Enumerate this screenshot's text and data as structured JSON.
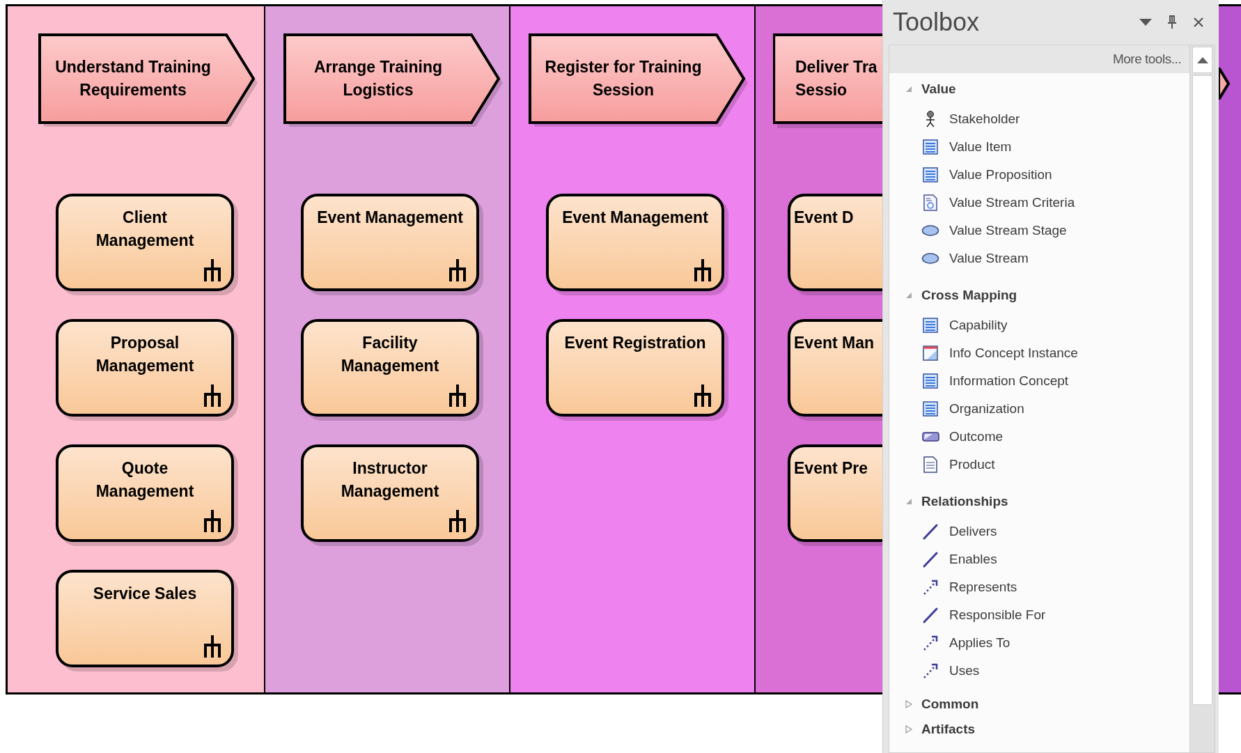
{
  "diagram": {
    "stages": [
      {
        "label": [
          "Understand Training",
          "Requirements"
        ],
        "color": "#fdbfcf",
        "capabilities": [
          {
            "label": [
              "Client",
              "Management"
            ]
          },
          {
            "label": [
              "Proposal",
              "Management"
            ]
          },
          {
            "label": [
              "Quote",
              "Management"
            ]
          },
          {
            "label": [
              "Service Sales"
            ]
          }
        ]
      },
      {
        "label": [
          "Arrange Training",
          "Logistics"
        ],
        "color": "#dda0dd",
        "capabilities": [
          {
            "label": [
              "Event Management"
            ]
          },
          {
            "label": [
              "Facility",
              "Management"
            ]
          },
          {
            "label": [
              "Instructor",
              "Management"
            ]
          }
        ]
      },
      {
        "label": [
          "Register for Training",
          "Session"
        ],
        "color": "#ee82ee",
        "capabilities": [
          {
            "label": [
              "Event Management"
            ]
          },
          {
            "label": [
              "Event Registration"
            ]
          }
        ]
      },
      {
        "label": [
          "Deliver Tra",
          "Sessio"
        ],
        "color": "#da70d6",
        "capabilities": [
          {
            "label": [
              "Event D"
            ]
          },
          {
            "label": [
              "Event Man"
            ]
          },
          {
            "label": [
              "Event Pre"
            ]
          }
        ]
      }
    ],
    "next_stage": {
      "color": "#b955d0"
    }
  },
  "toolbox": {
    "title": "Toolbox",
    "more_tools": "More tools...",
    "groups": [
      {
        "name": "Value",
        "expanded": true,
        "items": [
          {
            "label": "Stakeholder",
            "kind": "stakeholder"
          },
          {
            "label": "Value Item",
            "kind": "element"
          },
          {
            "label": "Value Proposition",
            "kind": "element"
          },
          {
            "label": "Value Stream Criteria",
            "kind": "criteria"
          },
          {
            "label": "Value Stream Stage",
            "kind": "stage"
          },
          {
            "label": "Value Stream",
            "kind": "stage"
          }
        ]
      },
      {
        "name": "Cross Mapping",
        "expanded": true,
        "items": [
          {
            "label": "Capability",
            "kind": "element"
          },
          {
            "label": "Info Concept Instance",
            "kind": "instance"
          },
          {
            "label": "Information Concept",
            "kind": "element"
          },
          {
            "label": "Organization",
            "kind": "element"
          },
          {
            "label": "Outcome",
            "kind": "outcome"
          },
          {
            "label": "Product",
            "kind": "product"
          }
        ]
      },
      {
        "name": "Relationships",
        "expanded": true,
        "items": [
          {
            "label": "Delivers",
            "kind": "association"
          },
          {
            "label": "Enables",
            "kind": "association"
          },
          {
            "label": "Represents",
            "kind": "dependency"
          },
          {
            "label": "Responsible For",
            "kind": "association"
          },
          {
            "label": "Applies To",
            "kind": "dependency"
          },
          {
            "label": "Uses",
            "kind": "dependency"
          }
        ]
      },
      {
        "name": "Common",
        "expanded": false
      },
      {
        "name": "Artifacts",
        "expanded": false
      }
    ]
  }
}
